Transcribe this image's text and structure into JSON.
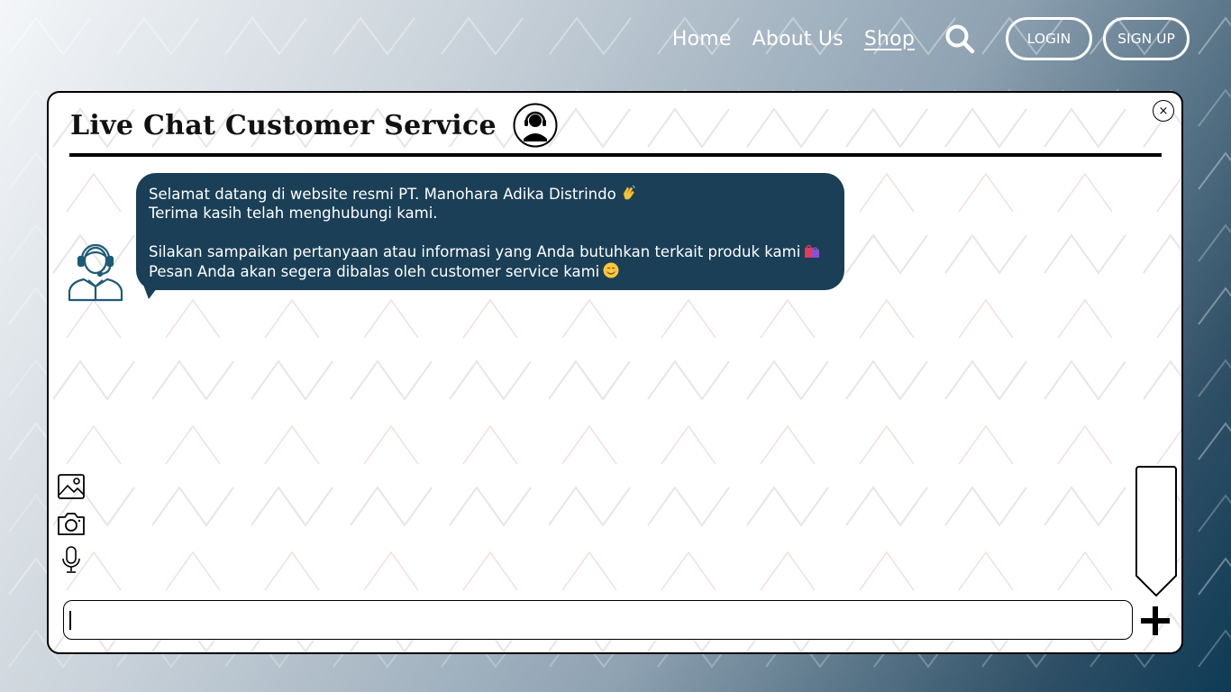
{
  "nav": {
    "links": [
      {
        "label": "Home"
      },
      {
        "label": "About Us"
      },
      {
        "label": "Shop"
      }
    ],
    "login_label": "LOGIN",
    "signup_label": "SIGN UP"
  },
  "chat": {
    "title": "Live Chat Customer Service",
    "close_symbol": "×",
    "message": {
      "line1": "Selamat datang di website resmi PT. Manohara Adika Distrindo",
      "line2": "Terima kasih telah menghubungi kami.",
      "line3": "Silakan sampaikan pertanyaan atau informasi yang Anda butuhkan terkait produk kami",
      "line4": "Pesan Anda akan segera dibalas oleh customer service kami"
    },
    "input": {
      "value": "",
      "placeholder": ""
    }
  },
  "icons": {
    "search": "search-icon",
    "header_badge": "customer-service-icon",
    "agent": "customer-service-agent-icon",
    "image": "image-icon",
    "camera": "camera-icon",
    "mic": "microphone-icon",
    "plus": "plus-icon",
    "wave_emoji": "waving-hand-emoji",
    "bags_emoji": "shopping-bags-emoji",
    "smile_emoji": "smiling-face-emoji"
  },
  "colors": {
    "bubble": "#1a3f56",
    "nav_text": "#ffffff",
    "panel_bg": "#ffffff",
    "accent_icon": "#1f5a78"
  }
}
